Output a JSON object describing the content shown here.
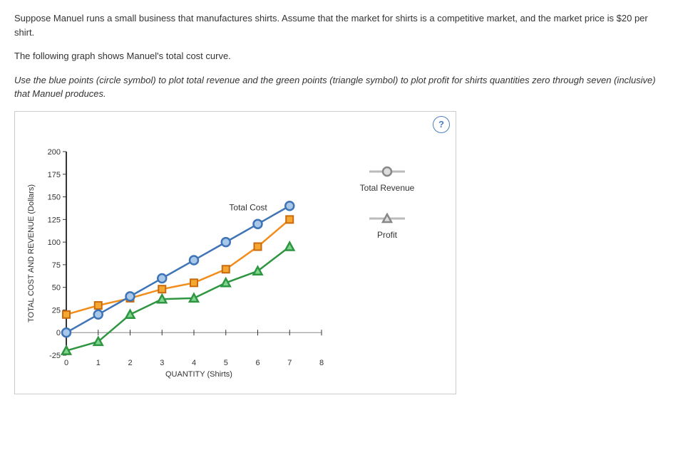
{
  "intro": {
    "p1": "Suppose Manuel runs a small business that manufactures shirts. Assume that the market for shirts is a competitive market, and the market price is $20 per shirt.",
    "p2": "The following graph shows Manuel's total cost curve.",
    "p3": "Use the blue points (circle symbol) to plot total revenue and the green points (triangle symbol) to plot profit for shirts quantities zero through seven (inclusive) that Manuel produces."
  },
  "help": "?",
  "legend": {
    "total_revenue": "Total Revenue",
    "profit": "Profit"
  },
  "inline_label_total_cost": "Total Cost",
  "axes": {
    "ylabel": "TOTAL COST AND REVENUE (Dollars)",
    "xlabel": "QUANTITY (Shirts)",
    "y_ticks": [
      "-25",
      "0",
      "25",
      "50",
      "75",
      "100",
      "125",
      "150",
      "175",
      "200"
    ],
    "x_ticks": [
      "0",
      "1",
      "2",
      "3",
      "4",
      "5",
      "6",
      "7",
      "8"
    ]
  },
  "chart_data": {
    "type": "line",
    "title": "",
    "xlabel": "QUANTITY (Shirts)",
    "ylabel": "TOTAL COST AND REVENUE (Dollars)",
    "xlim": [
      0,
      8
    ],
    "ylim": [
      -25,
      200
    ],
    "x": [
      0,
      1,
      2,
      3,
      4,
      5,
      6,
      7
    ],
    "series": [
      {
        "name": "Total Cost",
        "symbol": "square",
        "color": "#f28c1a",
        "values": [
          20,
          30,
          38,
          48,
          55,
          70,
          95,
          125
        ]
      },
      {
        "name": "Total Revenue",
        "symbol": "circle",
        "color": "#3f74b6",
        "values": [
          0,
          20,
          40,
          60,
          80,
          100,
          120,
          140
        ]
      },
      {
        "name": "Profit",
        "symbol": "triangle",
        "color": "#2e9640",
        "values": [
          -20,
          -10,
          20,
          37,
          38,
          55,
          68,
          95
        ]
      }
    ],
    "annotations": [
      {
        "text": "Total Cost",
        "x": 5.7,
        "y": 135
      }
    ]
  }
}
